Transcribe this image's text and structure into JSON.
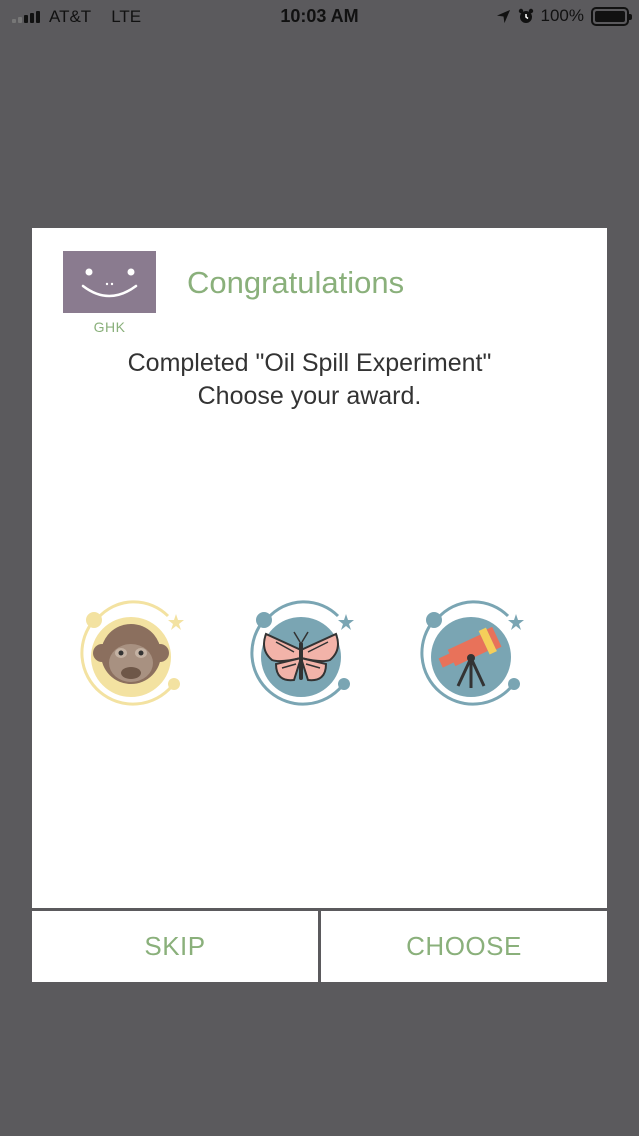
{
  "status_bar": {
    "carrier": "AT&T",
    "network": "LTE",
    "time": "10:03 AM",
    "battery": "100%",
    "icons": [
      "signal-icon",
      "location-arrow-icon",
      "alarm-clock-icon",
      "battery-icon"
    ]
  },
  "dialog": {
    "avatar_name": "GHK",
    "title": "Congratulations",
    "message_line1": "Completed \"Oil Spill Experiment\"",
    "message_line2": "Choose your award.",
    "awards": [
      {
        "name": "monkey-award-icon",
        "color": "#f3e2a1"
      },
      {
        "name": "butterfly-award-icon",
        "color": "#7aa5b3"
      },
      {
        "name": "telescope-award-icon",
        "color": "#7aa5b3"
      }
    ],
    "buttons": {
      "skip": "SKIP",
      "choose": "CHOOSE"
    }
  },
  "colors": {
    "backdrop": "#5b5a5d",
    "accent_green": "#8ab07b",
    "avatar_bg": "#8a7b8f",
    "dialog_bg": "#ffffff"
  }
}
